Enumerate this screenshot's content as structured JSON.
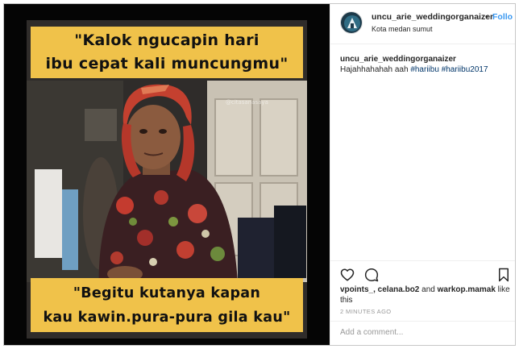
{
  "post": {
    "caption_top": "\"Kalok ngucapin hari\nibu cepat kali muncungmu\"",
    "caption_bottom": "\"Begitu kutanya kapan\nkau kawin.pura-pura gila kau\"",
    "watermark": "@citasanasaya",
    "colors": {
      "caption_bg": "#f0c24a",
      "photo_bg": "#050505"
    }
  },
  "header": {
    "username": "uncu_arie_weddingorganaizer",
    "separator": "•",
    "follow_label": "Follo",
    "location": "Kota medan sumut",
    "avatar_icon": "avatar-logo-icon"
  },
  "caption_comment": {
    "username": "uncu_arie_weddingorganaizer",
    "text": "Hajahhahahah aah",
    "hashtags": [
      "#hariibu",
      "#hariibu2017"
    ]
  },
  "actions": {
    "icons": [
      "heart-icon",
      "comment-bubble-icon",
      "bookmark-icon"
    ]
  },
  "likes": {
    "users": "vpoints_, celana.bo2",
    "and_text": "and",
    "last_user": "warkop.mamak",
    "suffix": "like this"
  },
  "timestamp": "2 MINUTES AGO",
  "add_comment": {
    "placeholder": "Add a comment..."
  },
  "colors": {
    "link": "#3897f0",
    "hashtag": "#003569",
    "muted": "#999999",
    "text": "#262626"
  }
}
